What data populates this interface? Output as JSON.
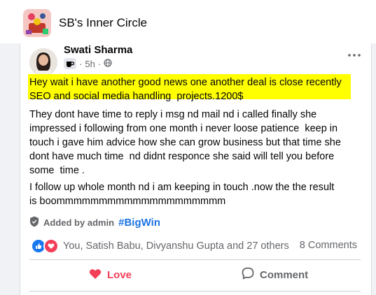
{
  "group": {
    "name": "SB's Inner Circle"
  },
  "post": {
    "author": "Swati Sharma",
    "time": "5h",
    "separator": "·",
    "highlighted_text": "Hey wait i have another good news one another deal is close recently\nSEO and social media handling  projects.1200$",
    "paragraph_1": "They dont have time to reply i msg nd mail nd i called finally she\nimpressed i following from one month i never loose patience  keep in\ntouch i gave him advice how she can grow business but that time she\ndont have much time  nd didnt responce she said will tell you before\nsome  time .",
    "paragraph_2": "I follow up whole month nd i am keeping in touch .now the the result\nis boommmmmmmmmmmmmmmmmmmm",
    "added_by": "Added by admin",
    "hashtag": "#BigWin",
    "reactors": "You, Satish Babu, Divyanshu Gupta and 27 others",
    "comments": "8 Comments"
  },
  "actions": {
    "love": "Love",
    "comment": "Comment"
  },
  "colors": {
    "highlight": "#ffff00",
    "love": "#f33e58",
    "link": "#1b74e4",
    "like": "#1877f2"
  }
}
